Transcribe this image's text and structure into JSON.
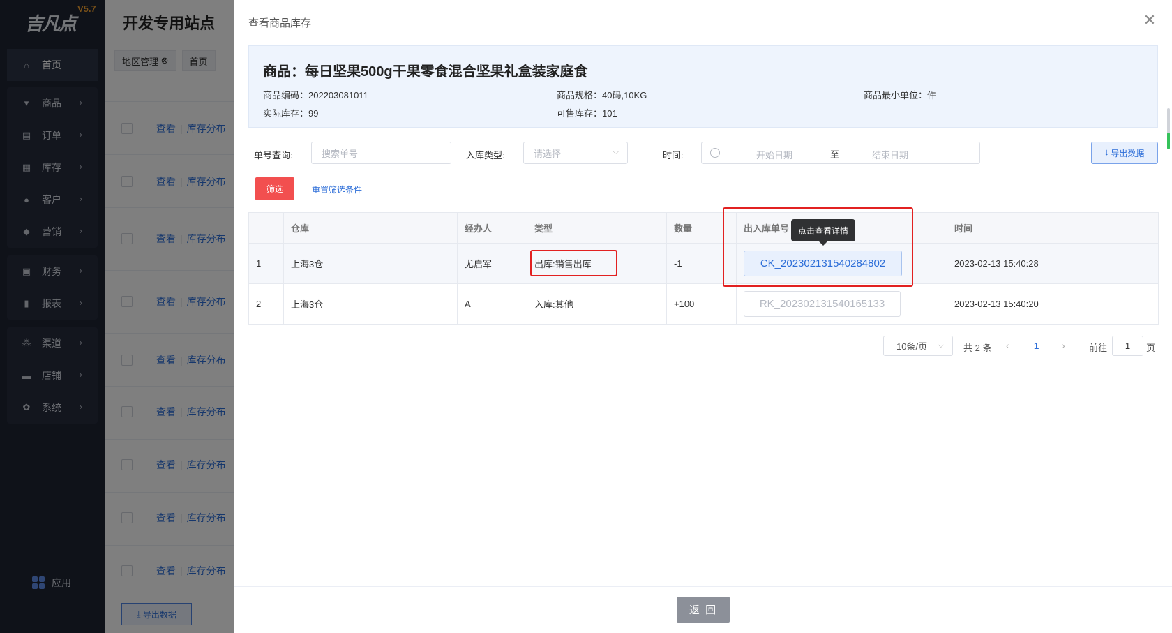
{
  "app": {
    "logo_text": "吉凡点",
    "version": "V5.7",
    "site_title": "开发专用站点"
  },
  "sidebar": {
    "items": [
      {
        "label": "首页",
        "icon": "home-icon"
      },
      {
        "label": "商品",
        "icon": "cart-icon"
      },
      {
        "label": "订单",
        "icon": "order-icon"
      },
      {
        "label": "库存",
        "icon": "grid-icon"
      },
      {
        "label": "客户",
        "icon": "user-icon"
      },
      {
        "label": "营销",
        "icon": "tag-icon"
      },
      {
        "label": "财务",
        "icon": "finance-icon"
      },
      {
        "label": "报表",
        "icon": "chart-icon"
      },
      {
        "label": "渠道",
        "icon": "channel-icon"
      },
      {
        "label": "店铺",
        "icon": "shop-icon"
      },
      {
        "label": "系统",
        "icon": "gear-icon"
      }
    ],
    "app_label": "应用"
  },
  "background": {
    "tabs": [
      "地区管理",
      "首页"
    ],
    "row_link_view": "查看",
    "row_link_stock": "库存分布",
    "export_label": "导出数据"
  },
  "drawer": {
    "title": "查看商品库存",
    "product": {
      "title": "商品：每日坚果500g干果零食混合坚果礼盒装家庭食",
      "code": "商品编码：202203081011",
      "spec": "商品规格：40码,10KG",
      "min_unit": "商品最小单位：件",
      "actual_stock": "实际库存：99",
      "available_stock": "可售库存：101"
    },
    "filters": {
      "order_label": "单号查询:",
      "order_placeholder": "搜索单号",
      "type_label": "入库类型:",
      "type_placeholder": "请选择",
      "time_label": "时间:",
      "start_placeholder": "开始日期",
      "to_label": "至",
      "end_placeholder": "结束日期",
      "export_label": "导出数据",
      "filter_button": "筛选",
      "reset_link": "重置筛选条件"
    },
    "table": {
      "headers": [
        "",
        "仓库",
        "经办人",
        "类型",
        "数量",
        "出入库单号",
        "时间"
      ],
      "rows": [
        {
          "index": "1",
          "warehouse": "上海3仓",
          "handler": "尤启军",
          "type": "出库:销售出库",
          "qty": "-1",
          "order_no": "CK_202302131540284802",
          "time": "2023-02-13 15:40:28"
        },
        {
          "index": "2",
          "warehouse": "上海3仓",
          "handler": "A",
          "type": "入库:其他",
          "qty": "+100",
          "order_no": "RK_202302131540165133",
          "time": "2023-02-13 15:40:20"
        }
      ]
    },
    "tooltip": "点击查看详情",
    "pagination": {
      "page_size": "10条/页",
      "total": "共 2 条",
      "current": "1",
      "goto_label": "前往",
      "goto_value": "1",
      "page_label": "页"
    },
    "back_button": "返 回"
  },
  "colors": {
    "accent": "#2d6ed8",
    "danger": "#f24f4f",
    "success": "#31a832",
    "highlight_box": "#e22121"
  }
}
